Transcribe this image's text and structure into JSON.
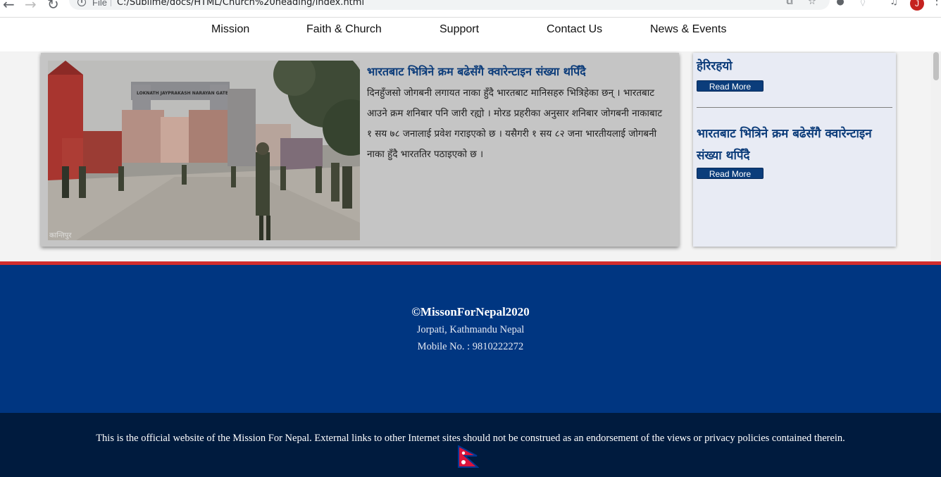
{
  "browser": {
    "scheme_label": "File",
    "url": "C:/Sublime/docs/HTML/Church%20heading/index.html",
    "profile_initial": "J"
  },
  "nav": {
    "items": [
      "Mission",
      "Faith & Church",
      "Support",
      "Contact Us",
      "News & Events"
    ]
  },
  "featured": {
    "title": "भारतबाट भित्रिने क्रम बढेसँगै क्वारेन्टाइन संख्या थपिँदै",
    "body": "दिनहुँजसो जोगबनी लगायत नाका हुँदै भारतबाट मानिसहरु भित्रिहेका छन् । भारतबाट आउने क्रम शनिबार पनि जारी रह्यो । मोरड प्रहरीका अनुसार शनिबार जोगबनी नाकाबाट १ सय ७८ जनालाई प्रवेश गराइएको छ । यसैगरी १ सय ८२ जना भारतीयलाई जोगबनी नाका हुँदै भारततिर पठाइएको छ ।",
    "photo_caption": "कान्तिपुर",
    "gate_sign": "LOKNATH JAYPRAKASH NARAYAN GATE"
  },
  "sidebar": {
    "item1_tail": "हेरिरहयो",
    "item2_title": "भारतबाट भित्रिने क्रम बढेसँगै क्वारेन्टाइन संख्या थपिँदै",
    "read_more": "Read More"
  },
  "footer": {
    "copyright": "©MissonForNepal2020",
    "address": "Jorpati, Kathmandu Nepal",
    "mobile": "Mobile No. : 9810222272",
    "disclaimer": "This is the official website of the Mission For Nepal. External links to other Internet sites should not be construed as an endorsement of the views or privacy policies contained therein."
  },
  "colors": {
    "accent_blue": "#0c3c7a",
    "footer_blue": "#003681",
    "footer_dark": "#001b3e",
    "footer_stripe": "#d22d2d"
  }
}
